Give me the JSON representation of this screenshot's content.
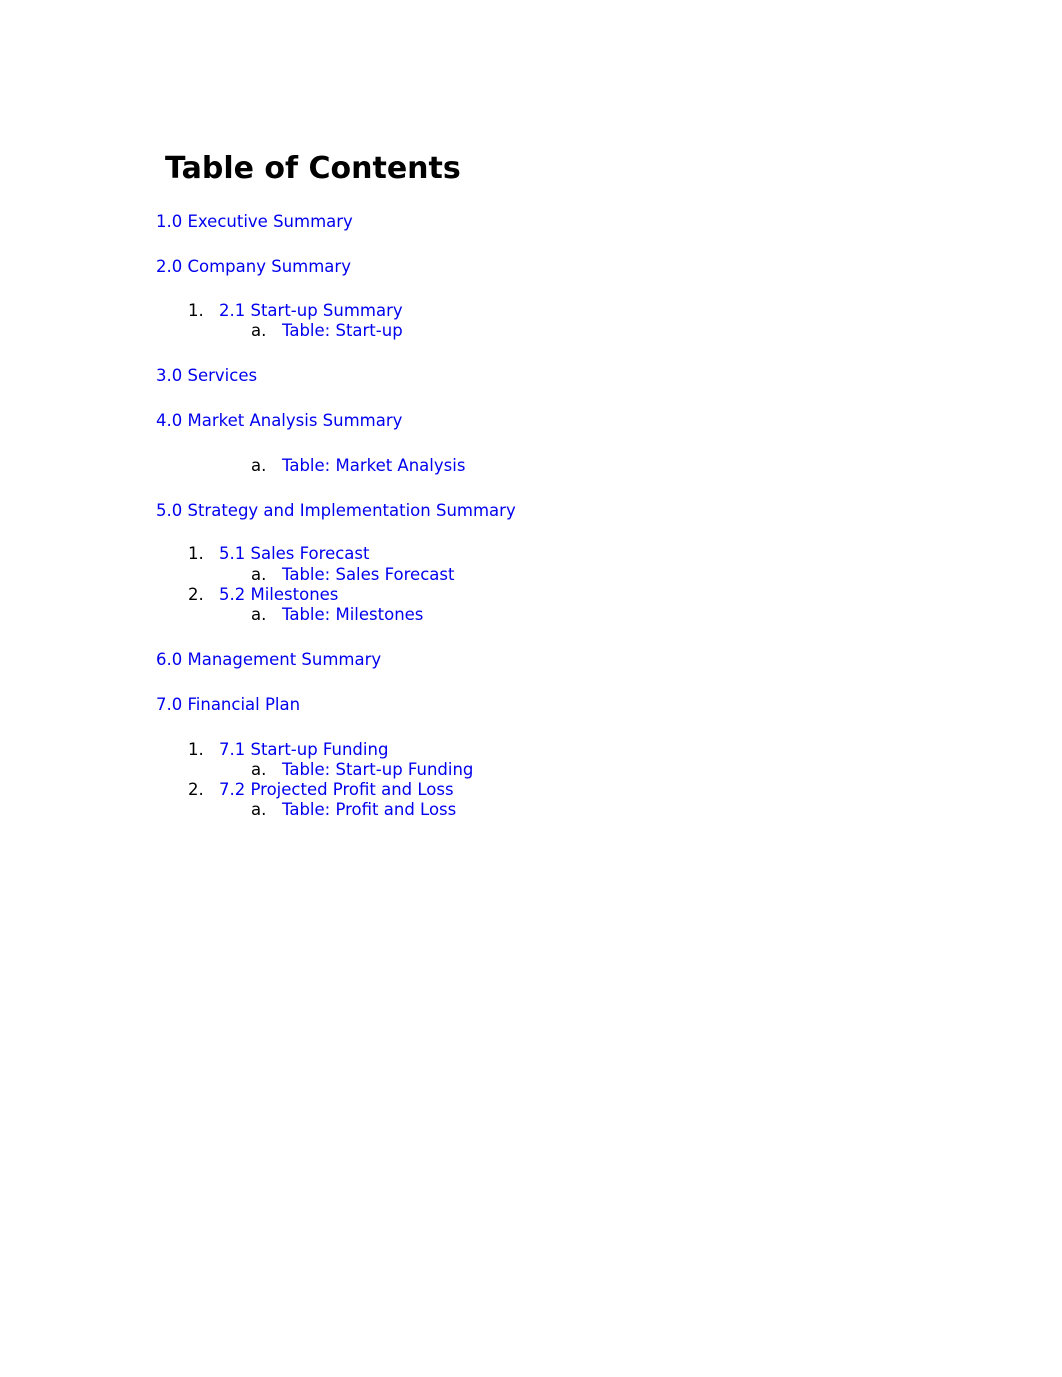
{
  "document": {
    "title": "Table of Contents",
    "link_color": "#0000ee",
    "entries": [
      {
        "label": "1.0 Executive Summary"
      },
      {
        "label": "2.0 Company Summary",
        "children": [
          {
            "marker": "1.",
            "label": "2.1 Start-up Summary",
            "children": [
              {
                "marker": "a.",
                "label": "Table: Start-up"
              }
            ]
          }
        ]
      },
      {
        "label": "3.0 Services"
      },
      {
        "label": "4.0 Market Analysis Summary",
        "children": [
          {
            "marker": "a.",
            "label": "Table: Market Analysis"
          }
        ]
      },
      {
        "label": "5.0 Strategy and Implementation Summary",
        "children": [
          {
            "marker": "1.",
            "label": "5.1 Sales Forecast",
            "children": [
              {
                "marker": "a.",
                "label": "Table: Sales Forecast"
              }
            ]
          },
          {
            "marker": "2.",
            "label": "5.2 Milestones",
            "children": [
              {
                "marker": "a.",
                "label": "Table: Milestones"
              }
            ]
          }
        ]
      },
      {
        "label": "6.0 Management Summary"
      },
      {
        "label": "7.0 Financial Plan",
        "children": [
          {
            "marker": "1.",
            "label": "7.1 Start-up Funding",
            "children": [
              {
                "marker": "a.",
                "label": "Table: Start-up Funding"
              }
            ]
          },
          {
            "marker": "2.",
            "label": "7.2 Projected Profit and Loss",
            "children": [
              {
                "marker": "a.",
                "label": "Table: Profit and Loss"
              }
            ]
          }
        ]
      }
    ]
  }
}
